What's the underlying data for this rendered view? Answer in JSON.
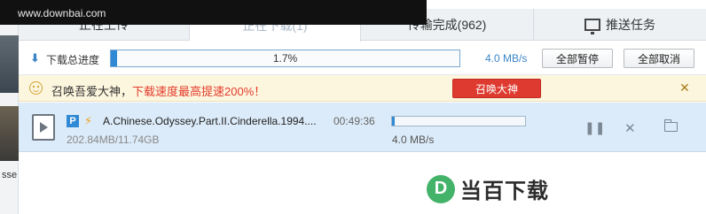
{
  "watermark": {
    "url": "www.downbai.com"
  },
  "sidebar": {
    "cut_text": "sse"
  },
  "tabs": [
    {
      "label": "正在上传"
    },
    {
      "label": "正在下载(1)"
    },
    {
      "label": "传输完成(962)"
    },
    {
      "label": "推送任务"
    }
  ],
  "total": {
    "label": "下载总进度",
    "progress_text": "1.7%",
    "progress": 0.017,
    "speed": "4.0 MB/s",
    "pause_all": "全部暂停",
    "cancel_all": "全部取消"
  },
  "banner": {
    "text": "召唤吾爱大神，",
    "highlight": "下载速度最高提速200%！",
    "button": "召唤大神",
    "close": "✕"
  },
  "task": {
    "badge": "P",
    "name": "A.Chinese.Odyssey.Part.II.Cinderella.1994....",
    "size": "202.84MB/11.74GB",
    "time": "00:49:36",
    "progress": 0.017,
    "speed": "4.0 MB/s"
  },
  "logo": {
    "letter": "D",
    "text": "当百下载"
  },
  "colors": {
    "accent": "#2f89d4",
    "banner_highlight": "#e33a2b",
    "summon_button": "#de3a2f",
    "row_selected": "#dcebf9"
  }
}
